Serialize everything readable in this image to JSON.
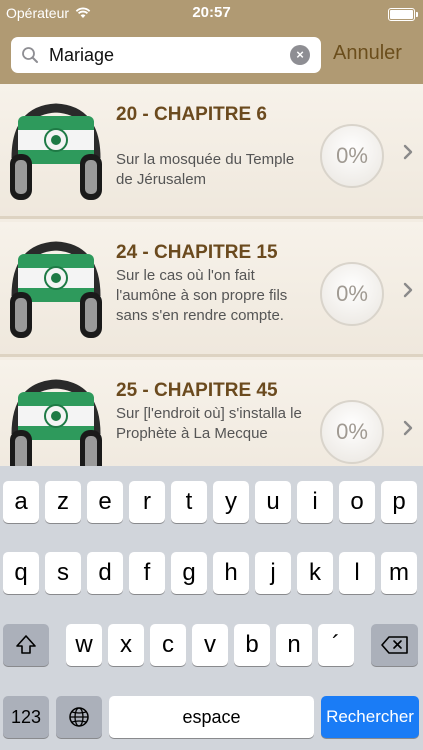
{
  "status_bar": {
    "carrier": "Opérateur",
    "time": "20:57"
  },
  "search": {
    "value": "Mariage",
    "cancel_label": "Annuler"
  },
  "results": [
    {
      "title": "20 - CHAPITRE 6",
      "subtitle": "Sur la mosquée du Temple de Jérusalem",
      "progress": "0%"
    },
    {
      "title": "24 - CHAPITRE 15",
      "subtitle": "Sur le cas où l'on fait l'aumône à son propre fils sans s'en rendre compte.",
      "progress": "0%"
    },
    {
      "title": "25 - CHAPITRE 45",
      "subtitle": "Sur [l'endroit où] s'installa le Prophète  à La Mecque",
      "progress": "0%"
    }
  ],
  "keyboard": {
    "row1": [
      "a",
      "z",
      "e",
      "r",
      "t",
      "y",
      "u",
      "i",
      "o",
      "p"
    ],
    "row2": [
      "q",
      "s",
      "d",
      "f",
      "g",
      "h",
      "j",
      "k",
      "l",
      "m"
    ],
    "row3": [
      "w",
      "x",
      "c",
      "v",
      "b",
      "n",
      "´"
    ],
    "numbers_label": "123",
    "space_label": "espace",
    "search_label": "Rechercher"
  },
  "icons": {
    "wifi": "wifi-icon",
    "battery": "battery-icon",
    "search": "magnifier-icon",
    "clear": "clear-icon",
    "chevron": "chevron-right-icon",
    "shift": "shift-icon",
    "backspace": "backspace-icon",
    "globe": "globe-icon"
  },
  "colors": {
    "header": "#b09a73",
    "title": "#6b4a1e",
    "search_key": "#1a7cf6"
  }
}
